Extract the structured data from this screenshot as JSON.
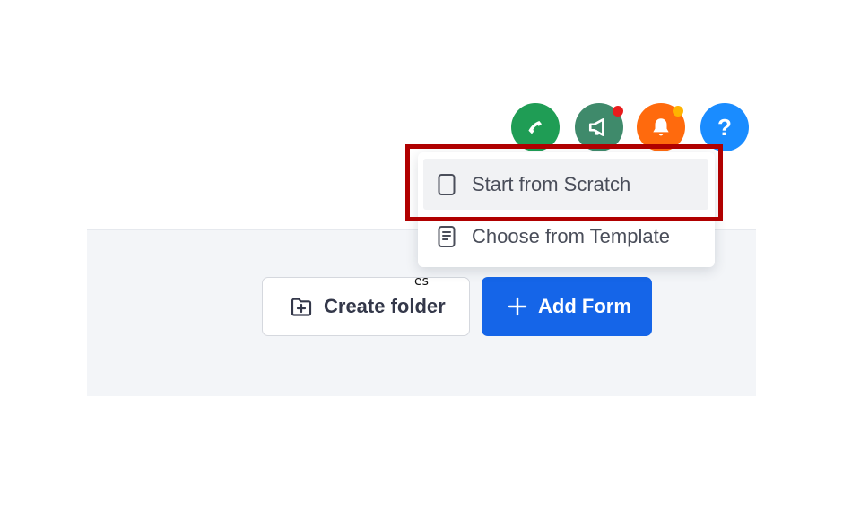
{
  "header": {
    "icons": [
      {
        "name": "phone-icon",
        "color": "#1f9d55"
      },
      {
        "name": "megaphone-icon",
        "color": "#3f8a6b",
        "badge_color": "#e81c1c"
      },
      {
        "name": "bell-icon",
        "color": "#ff6a0d",
        "badge_color": "#ffb300"
      },
      {
        "name": "help-icon",
        "color": "#1a8cff",
        "glyph": "?"
      }
    ]
  },
  "dropdown": {
    "items": [
      {
        "label": "Start from Scratch",
        "icon": "blank-page-icon"
      },
      {
        "label": "Choose from Template",
        "icon": "template-page-icon"
      }
    ],
    "highlight_color": "#b00000"
  },
  "toolbar": {
    "create_folder_label": "Create folder",
    "add_form_label": "Add Form",
    "add_form_color": "#1565e8"
  },
  "stray_text": "es"
}
